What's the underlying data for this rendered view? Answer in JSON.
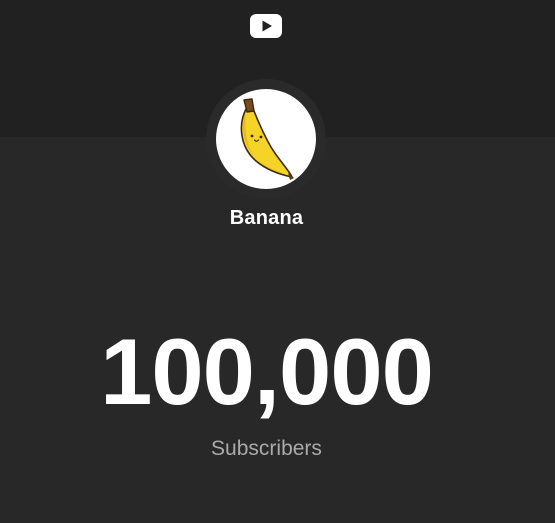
{
  "header": {
    "logo_icon": "youtube-play-icon"
  },
  "channel": {
    "avatar_icon": "banana-avatar",
    "name": "Banana"
  },
  "counter": {
    "value": "100,000",
    "label": "Subscribers"
  },
  "colors": {
    "background": "#282828",
    "header_band": "#212121",
    "text_primary": "#ffffff",
    "text_secondary": "#aaaaaa",
    "banana_yellow": "#f5d327"
  }
}
